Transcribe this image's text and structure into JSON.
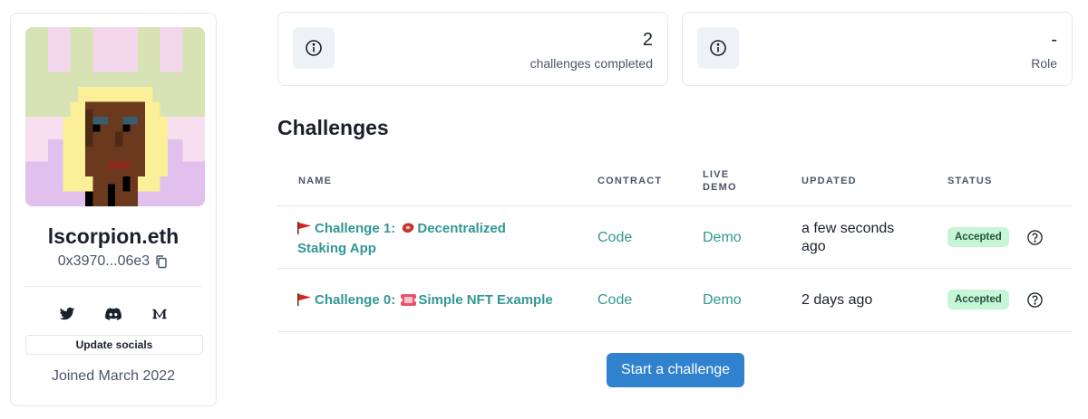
{
  "profile": {
    "ens_name": "lscorpion.eth",
    "address": "0x3970...06e3",
    "socials": [
      "twitter-icon",
      "discord-icon",
      "medium-icon"
    ],
    "update_socials_label": "Update socials",
    "joined": "Joined March 2022"
  },
  "stats": [
    {
      "value": "2",
      "label": "challenges completed",
      "icon": "info-icon"
    },
    {
      "value": "-",
      "label": "Role",
      "icon": "info-icon"
    }
  ],
  "challenges": {
    "title": "Challenges",
    "columns": {
      "name": "NAME",
      "contract": "CONTRACT",
      "live_demo_1": "LIVE",
      "live_demo_2": "DEMO",
      "updated": "UPDATED",
      "status": "STATUS"
    },
    "rows": [
      {
        "name_line1": "Challenge 1:",
        "name_line1_rest": "Decentralized",
        "name_line2": "Staking App",
        "contract": "Code",
        "demo": "Demo",
        "updated_line1": "a few seconds",
        "updated_line2": "ago",
        "status": "Accepted"
      },
      {
        "name_line1": "Challenge 0:",
        "name_line1_rest": "Simple NFT Example",
        "contract": "Code",
        "demo": "Demo",
        "updated_line1": "2 days ago",
        "status": "Accepted"
      }
    ]
  },
  "start_button_label": "Start a challenge",
  "colors": {
    "accent_teal": "#319795",
    "primary_blue": "#3182ce",
    "badge_bg": "#c6f6d5",
    "badge_text": "#22543d"
  }
}
